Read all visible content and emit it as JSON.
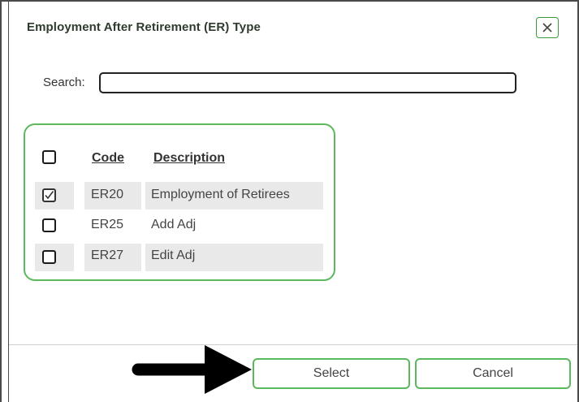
{
  "dialog": {
    "title": "Employment After Retirement (ER) Type",
    "close_icon": "close-x-icon"
  },
  "search": {
    "label": "Search:",
    "value": "",
    "placeholder": ""
  },
  "table": {
    "columns": [
      "Code",
      "Description"
    ],
    "select_all_checked": false,
    "rows": [
      {
        "code": "ER20",
        "description": "Employment of Retirees",
        "checked": true
      },
      {
        "code": "ER25",
        "description": "Add Adj",
        "checked": false
      },
      {
        "code": "ER27",
        "description": "Edit Adj",
        "checked": false
      }
    ]
  },
  "footer": {
    "select_label": "Select",
    "cancel_label": "Cancel"
  },
  "colors": {
    "accent_green": "#5cb85c",
    "row_shade": "#e9e9e9",
    "arrow": "#000000"
  },
  "annotations": {
    "pointer_icon": "right-arrow-icon"
  }
}
